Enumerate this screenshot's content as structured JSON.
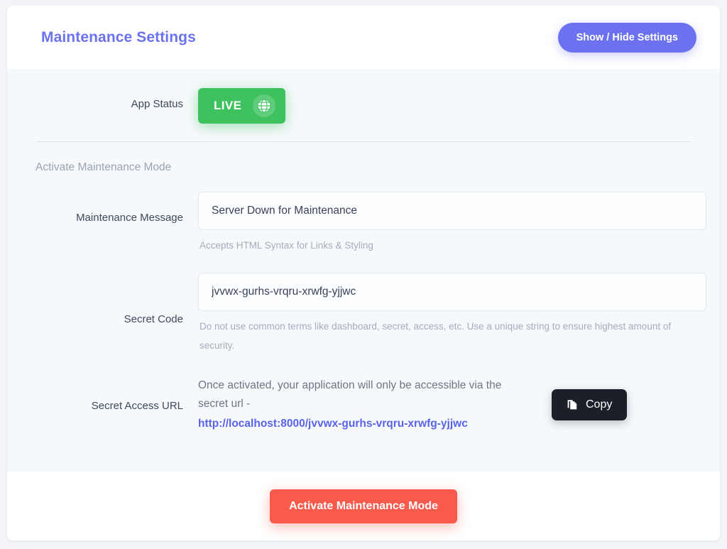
{
  "header": {
    "title": "Maintenance Settings",
    "toggle_button_label": "Show / Hide Settings",
    "title_color": "#6b72ef",
    "button_color": "#6c72ef"
  },
  "app_status": {
    "label": "App Status",
    "value": "LIVE",
    "badge_color": "#3ec15f",
    "icon": "globe-icon"
  },
  "section": {
    "title": "Activate Maintenance Mode"
  },
  "maintenance_message": {
    "label": "Maintenance Message",
    "value": "Server Down for Maintenance",
    "placeholder": "Maintenance Message",
    "helper": "Accepts HTML Syntax for Links & Styling"
  },
  "secret_code": {
    "label": "Secret Code",
    "value": "jvvwx-gurhs-vrqru-xrwfg-yjjwc",
    "placeholder": "Secret Code",
    "helper": "Do not use common terms like dashboard, secret, access, etc. Use a unique string to ensure highest amount of security."
  },
  "secret_access_url": {
    "label": "Secret Access URL",
    "description": "Once activated, your application will only be accessible via the secret url -",
    "url": "http://localhost:8000/jvvwx-gurhs-vrqru-xrwfg-yjjwc",
    "url_color": "#5a63e8",
    "copy_button_label": "Copy",
    "copy_icon": "copy-icon"
  },
  "footer": {
    "activate_button_label": "Activate Maintenance Mode",
    "activate_button_color": "#fa5a4b"
  }
}
